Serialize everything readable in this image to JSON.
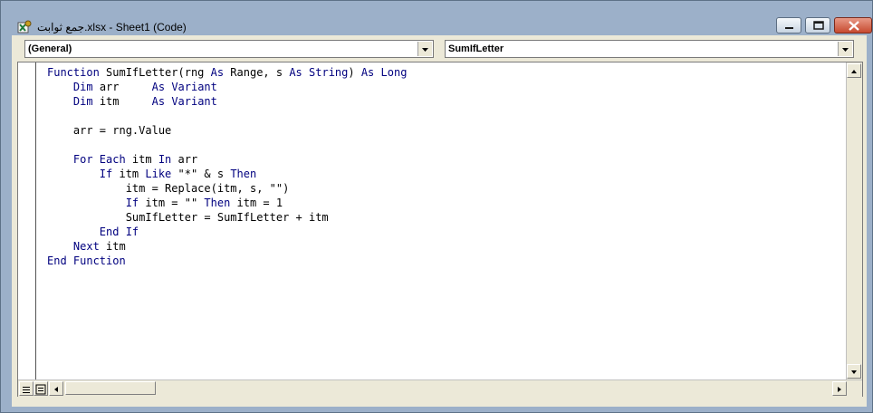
{
  "window": {
    "title": "جمع ثوابت.xlsx - Sheet1 (Code)",
    "app_icon": "excel-vba-icon",
    "buttons": {
      "minimize_icon": "minimize-icon",
      "maximize_icon": "maximize-icon",
      "close_icon": "close-icon"
    }
  },
  "combos": {
    "object": "(General)",
    "procedure": "SumIfLetter"
  },
  "code": {
    "lines": [
      [
        {
          "t": "Function",
          "k": 1
        },
        {
          "t": " SumIfLetter(rng "
        },
        {
          "t": "As",
          "k": 1
        },
        {
          "t": " Range, s "
        },
        {
          "t": "As",
          "k": 1
        },
        {
          "t": " "
        },
        {
          "t": "String",
          "k": 1
        },
        {
          "t": ") "
        },
        {
          "t": "As",
          "k": 1
        },
        {
          "t": " "
        },
        {
          "t": "Long",
          "k": 1
        }
      ],
      [
        {
          "t": "    "
        },
        {
          "t": "Dim",
          "k": 1
        },
        {
          "t": " arr     "
        },
        {
          "t": "As",
          "k": 1
        },
        {
          "t": " "
        },
        {
          "t": "Variant",
          "k": 1
        }
      ],
      [
        {
          "t": "    "
        },
        {
          "t": "Dim",
          "k": 1
        },
        {
          "t": " itm     "
        },
        {
          "t": "As",
          "k": 1
        },
        {
          "t": " "
        },
        {
          "t": "Variant",
          "k": 1
        }
      ],
      [
        {
          "t": ""
        }
      ],
      [
        {
          "t": "    arr = rng.Value"
        }
      ],
      [
        {
          "t": ""
        }
      ],
      [
        {
          "t": "    "
        },
        {
          "t": "For Each",
          "k": 1
        },
        {
          "t": " itm "
        },
        {
          "t": "In",
          "k": 1
        },
        {
          "t": " arr"
        }
      ],
      [
        {
          "t": "        "
        },
        {
          "t": "If",
          "k": 1
        },
        {
          "t": " itm "
        },
        {
          "t": "Like",
          "k": 1
        },
        {
          "t": " \"*\" & s "
        },
        {
          "t": "Then",
          "k": 1
        }
      ],
      [
        {
          "t": "            itm = Replace(itm, s, \"\")"
        }
      ],
      [
        {
          "t": "            "
        },
        {
          "t": "If",
          "k": 1
        },
        {
          "t": " itm = \"\" "
        },
        {
          "t": "Then",
          "k": 1
        },
        {
          "t": " itm = 1"
        }
      ],
      [
        {
          "t": "            SumIfLetter = SumIfLetter + itm"
        }
      ],
      [
        {
          "t": "        "
        },
        {
          "t": "End If",
          "k": 1
        }
      ],
      [
        {
          "t": "    "
        },
        {
          "t": "Next",
          "k": 1
        },
        {
          "t": " itm"
        }
      ],
      [
        {
          "t": "End Function",
          "k": 1
        }
      ]
    ]
  },
  "icons": {
    "dropdown": "chevron-down-icon",
    "scroll_up": "arrow-up-icon",
    "scroll_down": "arrow-down-icon",
    "scroll_left": "arrow-left-icon",
    "scroll_right": "arrow-right-icon",
    "procedure_view": "procedure-view-icon",
    "full_module_view": "full-module-view-icon"
  },
  "colors": {
    "keyword": "#00007f",
    "text": "#000000",
    "frame": "#9cb0c9"
  }
}
